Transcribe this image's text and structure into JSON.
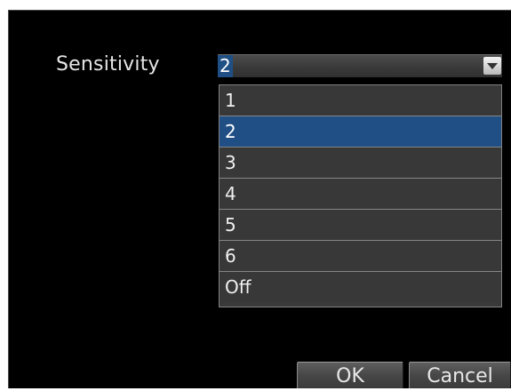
{
  "dialog": {
    "field_label": "Sensitivity",
    "select": {
      "value": "2",
      "options": [
        "1",
        "2",
        "3",
        "4",
        "5",
        "6",
        "Off"
      ],
      "selected_index": 1
    },
    "buttons": {
      "ok_label": "OK",
      "cancel_label": "Cancel"
    }
  },
  "colors": {
    "background": "#000000",
    "highlight": "#1f4f84",
    "option_bg": "#383838",
    "text": "#f0f0f0"
  }
}
